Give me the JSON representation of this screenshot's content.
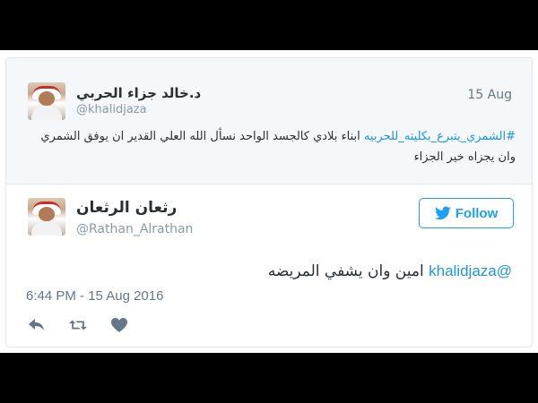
{
  "parent_tweet": {
    "author_name": "د.خالد جزاء الحربي",
    "handle": "@khalidjaza",
    "date": "15 Aug",
    "hashtag": "#الشمري_يتبرع_بكليته_للحربيه",
    "text_rest": " ابناء بلادي كالجسد الواحد نسأل الله العلي القدير ان يوفق الشمري وان يجزاه خير الجزاء"
  },
  "reply_tweet": {
    "author_name": "رثعان الرثعان",
    "handle": "@Rathan_Alrathan",
    "follow_label": "Follow",
    "mention": "@khalidjaza",
    "text": "امين وان يشفي المريضه",
    "timestamp": "6:44 PM - 15 Aug 2016"
  },
  "actions": {
    "reply_icon": "reply-icon",
    "retweet_icon": "retweet-icon",
    "like_icon": "heart-icon"
  },
  "colors": {
    "accent": "#1da1f2",
    "link": "#1b95e0",
    "muted": "#8899a6",
    "text": "#292f33",
    "parent_bg": "#f5f8fa"
  }
}
